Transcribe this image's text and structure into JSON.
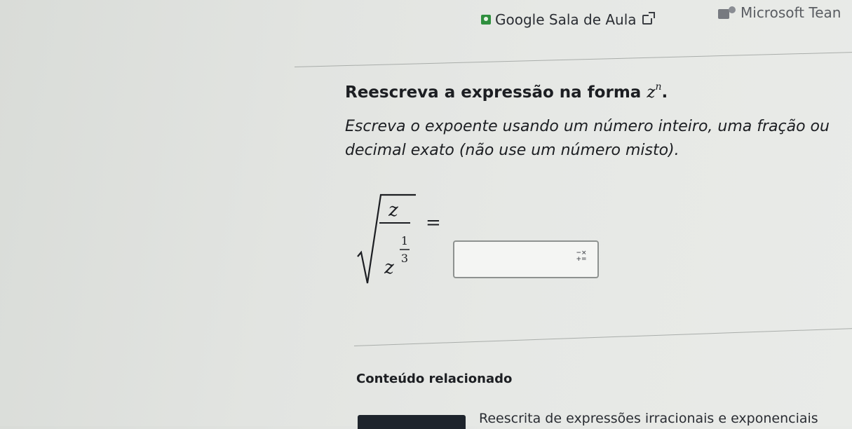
{
  "top_links": {
    "classroom": "Google Sala de Aula",
    "teams": "Microsoft Tean"
  },
  "question": {
    "heading_prefix": "Reescreva a expressão na forma",
    "heading_base": "z",
    "heading_exponent": "n",
    "heading_suffix": ".",
    "instructions_line1": "Escreva o expoente usando um número inteiro, uma fração ou",
    "instructions_line2": "decimal exato (não use um número misto)."
  },
  "expression": {
    "numerator": "z",
    "denominator_base": "z",
    "exponent_numerator": "1",
    "exponent_denominator": "3",
    "equals": "="
  },
  "answer": {
    "value": "",
    "keypad_icon": "math-keypad-icon",
    "keypad_symbols_top": "−×",
    "keypad_symbols_bottom": "+="
  },
  "related": {
    "heading": "Conteúdo relacionado",
    "link": "Reescrita de expressões irracionais e exponenciais"
  },
  "colors": {
    "classroom_icon": "#2f8f3e",
    "text": "#1c1e22",
    "border": "#8e9290"
  }
}
